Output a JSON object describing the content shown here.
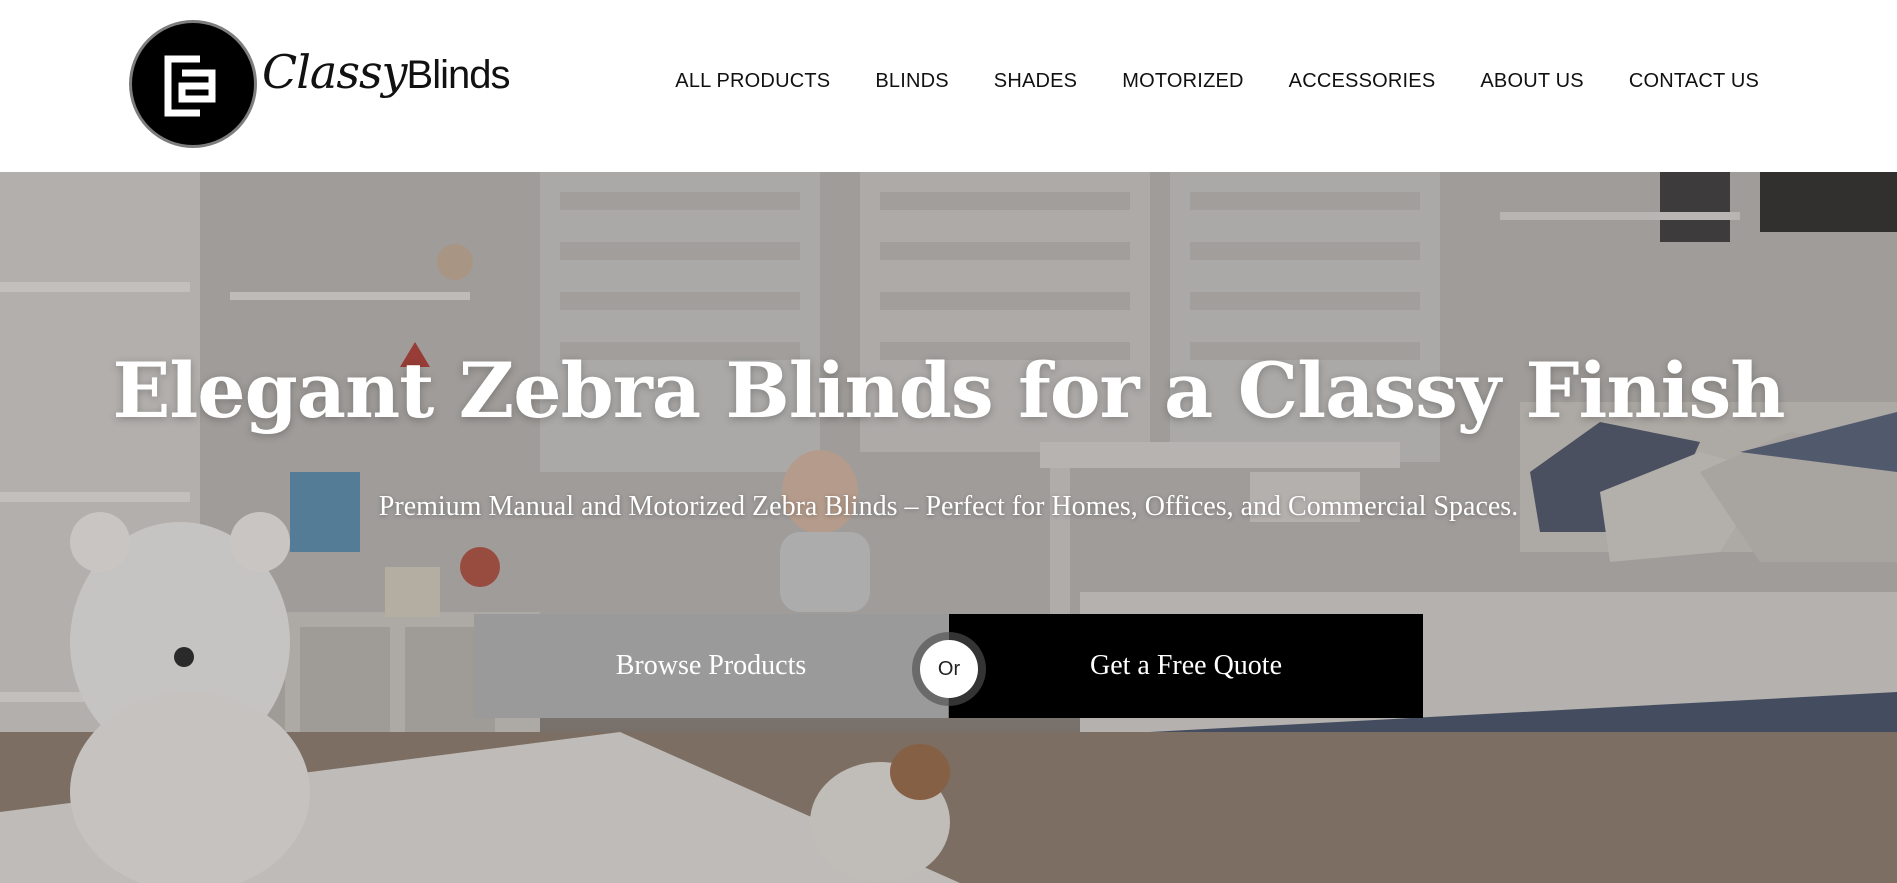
{
  "brand": {
    "logo_word_1": "Classy",
    "logo_word_2": "Blinds"
  },
  "nav": {
    "items": [
      {
        "label": "ALL PRODUCTS"
      },
      {
        "label": "BLINDS"
      },
      {
        "label": "SHADES"
      },
      {
        "label": "MOTORIZED"
      },
      {
        "label": "ACCESSORIES"
      },
      {
        "label": "ABOUT US"
      },
      {
        "label": "CONTACT US"
      }
    ]
  },
  "hero": {
    "title": "Elegant Zebra Blinds for a Classy Finish",
    "subtitle": "Premium Manual and Motorized Zebra Blinds – Perfect for Homes, Offices, and Commercial Spaces.",
    "browse_label": "Browse Products",
    "divider_label": "Or",
    "quote_label": "Get a Free Quote"
  },
  "colors": {
    "browse_button": "#9a9a9a",
    "quote_button": "#000000",
    "header_bg": "#ffffff",
    "text_dark": "#111111"
  },
  "icons": {
    "logo": "cb-monogram-icon"
  }
}
